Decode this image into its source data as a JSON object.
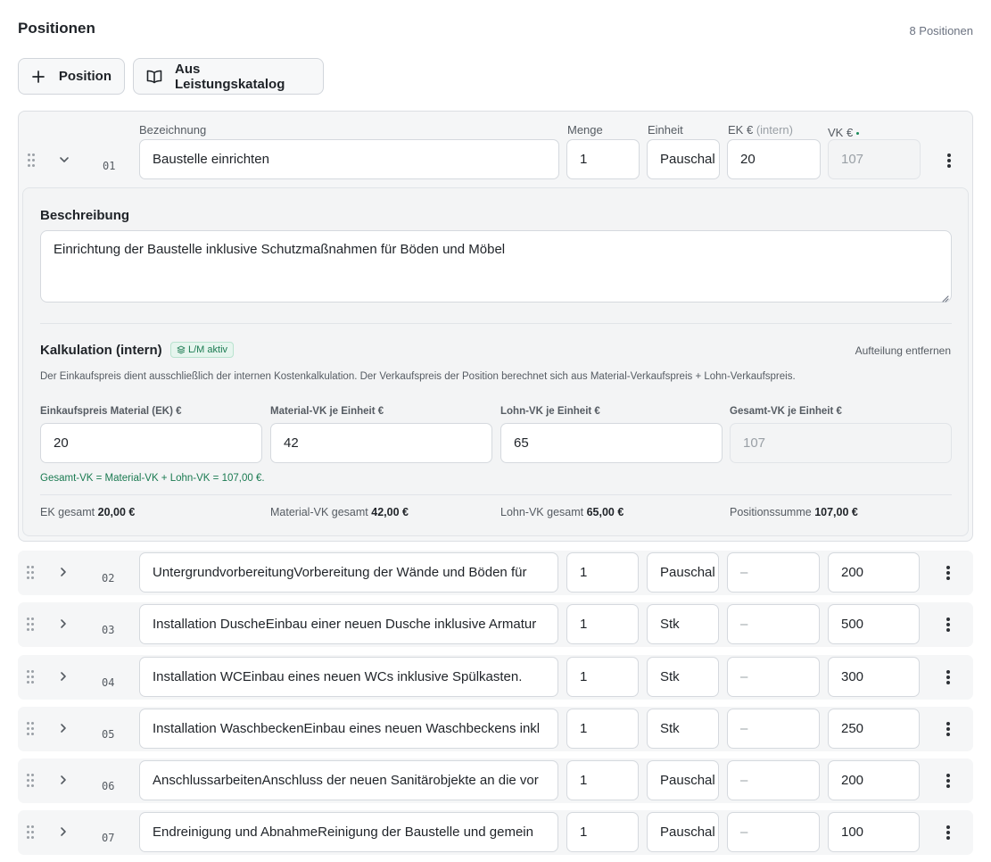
{
  "header": {
    "title": "Positionen",
    "count": "8 Positionen"
  },
  "toolbar": {
    "add_label": "Position",
    "catalog_label": "Aus Leistungskatalog"
  },
  "columns": {
    "bezeichnung": "Bezeichnung",
    "menge": "Menge",
    "einheit": "Einheit",
    "ek": "EK €",
    "ek_note": "(intern)",
    "vk": "VK €"
  },
  "expanded": {
    "num": "01",
    "bezeichnung": "Baustelle einrichten",
    "menge": "1",
    "einheit": "Pauschal",
    "ek": "20",
    "vk": "107",
    "beschreibung_label": "Beschreibung",
    "beschreibung": "Einrichtung der Baustelle inklusive Schutzmaßnahmen für Böden und Möbel",
    "kalkulation": {
      "title": "Kalkulation (intern)",
      "badge": "L/M aktiv",
      "remove": "Aufteilung entfernen",
      "hint": "Der Einkaufspreis dient ausschließlich der internen Kostenkalkulation. Der Verkaufspreis der Position berechnet sich aus Material-Verkaufspreis + Lohn-Verkaufspreis.",
      "fields": [
        {
          "label": "Einkaufspreis Material (EK) €",
          "value": "20"
        },
        {
          "label": "Material-VK je Einheit €",
          "value": "42"
        },
        {
          "label": "Lohn-VK je Einheit €",
          "value": "65"
        },
        {
          "label": "Gesamt-VK je Einheit €",
          "value": "107"
        }
      ],
      "formula": "Gesamt-VK = Material-VK + Lohn-VK = 107,00 €.",
      "totals": [
        {
          "label": "EK gesamt",
          "value": "20,00 €"
        },
        {
          "label": "Material-VK gesamt",
          "value": "42,00 €"
        },
        {
          "label": "Lohn-VK gesamt",
          "value": "65,00 €"
        },
        {
          "label": "Positionssumme",
          "value": "107,00 €"
        }
      ]
    }
  },
  "rows": [
    {
      "num": "02",
      "bezeichnung": "UntergrundvorbereitungVorbereitung der Wände und Böden für",
      "menge": "1",
      "einheit": "Pauschal",
      "ek": "–",
      "vk": "200"
    },
    {
      "num": "03",
      "bezeichnung": "Installation DuscheEinbau einer neuen Dusche inklusive Armatur",
      "menge": "1",
      "einheit": "Stk",
      "ek": "–",
      "vk": "500"
    },
    {
      "num": "04",
      "bezeichnung": "Installation WCEinbau eines neuen WCs inklusive Spülkasten.",
      "menge": "1",
      "einheit": "Stk",
      "ek": "–",
      "vk": "300"
    },
    {
      "num": "05",
      "bezeichnung": "Installation WaschbeckenEinbau eines neuen Waschbeckens inkl",
      "menge": "1",
      "einheit": "Stk",
      "ek": "–",
      "vk": "250"
    },
    {
      "num": "06",
      "bezeichnung": "AnschlussarbeitenAnschluss der neuen Sanitärobjekte an die vor",
      "menge": "1",
      "einheit": "Pauschal",
      "ek": "–",
      "vk": "200"
    },
    {
      "num": "07",
      "bezeichnung": "Endreinigung und AbnahmeReinigung der Baustelle und gemein",
      "menge": "1",
      "einheit": "Pauschal",
      "ek": "–",
      "vk": "100"
    }
  ]
}
